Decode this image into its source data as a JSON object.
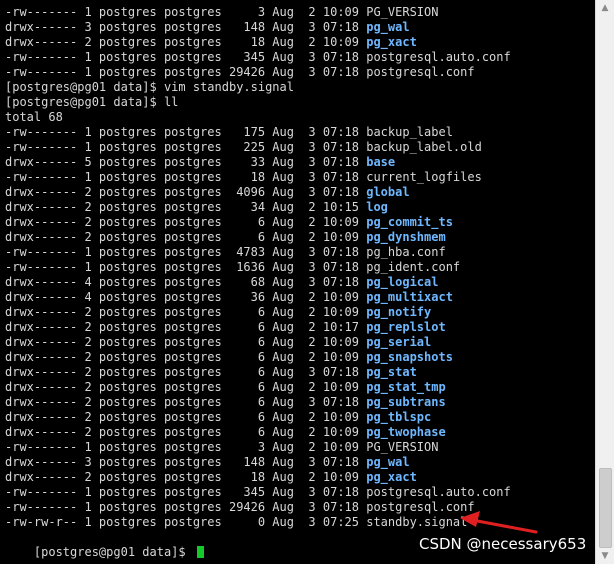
{
  "terminal": {
    "lines": [
      {
        "prefix": "-rw------- 1 postgres postgres     3 Aug  2 10:09 ",
        "name": "PG_VERSION",
        "dir": false
      },
      {
        "prefix": "drwx------ 3 postgres postgres   148 Aug  3 07:18 ",
        "name": "pg_wal",
        "dir": true
      },
      {
        "prefix": "drwx------ 2 postgres postgres    18 Aug  2 10:09 ",
        "name": "pg_xact",
        "dir": true
      },
      {
        "prefix": "-rw------- 1 postgres postgres   345 Aug  3 07:18 ",
        "name": "postgresql.auto.conf",
        "dir": false
      },
      {
        "prefix": "-rw------- 1 postgres postgres 29426 Aug  3 07:18 ",
        "name": "postgresql.conf",
        "dir": false
      },
      {
        "prefix": "[postgres@pg01 data]$ vim standby.signal",
        "name": "",
        "dir": false
      },
      {
        "prefix": "[postgres@pg01 data]$ ll",
        "name": "",
        "dir": false
      },
      {
        "prefix": "total 68",
        "name": "",
        "dir": false
      },
      {
        "prefix": "-rw------- 1 postgres postgres   175 Aug  3 07:18 ",
        "name": "backup_label",
        "dir": false
      },
      {
        "prefix": "-rw------- 1 postgres postgres   225 Aug  3 07:18 ",
        "name": "backup_label.old",
        "dir": false
      },
      {
        "prefix": "drwx------ 5 postgres postgres    33 Aug  3 07:18 ",
        "name": "base",
        "dir": true
      },
      {
        "prefix": "-rw------- 1 postgres postgres    18 Aug  3 07:18 ",
        "name": "current_logfiles",
        "dir": false
      },
      {
        "prefix": "drwx------ 2 postgres postgres  4096 Aug  3 07:18 ",
        "name": "global",
        "dir": true
      },
      {
        "prefix": "drwx------ 2 postgres postgres    34 Aug  2 10:15 ",
        "name": "log",
        "dir": true
      },
      {
        "prefix": "drwx------ 2 postgres postgres     6 Aug  2 10:09 ",
        "name": "pg_commit_ts",
        "dir": true
      },
      {
        "prefix": "drwx------ 2 postgres postgres     6 Aug  2 10:09 ",
        "name": "pg_dynshmem",
        "dir": true
      },
      {
        "prefix": "-rw------- 1 postgres postgres  4783 Aug  3 07:18 ",
        "name": "pg_hba.conf",
        "dir": false
      },
      {
        "prefix": "-rw------- 1 postgres postgres  1636 Aug  3 07:18 ",
        "name": "pg_ident.conf",
        "dir": false
      },
      {
        "prefix": "drwx------ 4 postgres postgres    68 Aug  3 07:18 ",
        "name": "pg_logical",
        "dir": true
      },
      {
        "prefix": "drwx------ 4 postgres postgres    36 Aug  2 10:09 ",
        "name": "pg_multixact",
        "dir": true
      },
      {
        "prefix": "drwx------ 2 postgres postgres     6 Aug  2 10:09 ",
        "name": "pg_notify",
        "dir": true
      },
      {
        "prefix": "drwx------ 2 postgres postgres     6 Aug  2 10:17 ",
        "name": "pg_replslot",
        "dir": true
      },
      {
        "prefix": "drwx------ 2 postgres postgres     6 Aug  2 10:09 ",
        "name": "pg_serial",
        "dir": true
      },
      {
        "prefix": "drwx------ 2 postgres postgres     6 Aug  2 10:09 ",
        "name": "pg_snapshots",
        "dir": true
      },
      {
        "prefix": "drwx------ 2 postgres postgres     6 Aug  3 07:18 ",
        "name": "pg_stat",
        "dir": true
      },
      {
        "prefix": "drwx------ 2 postgres postgres     6 Aug  2 10:09 ",
        "name": "pg_stat_tmp",
        "dir": true
      },
      {
        "prefix": "drwx------ 2 postgres postgres     6 Aug  3 07:18 ",
        "name": "pg_subtrans",
        "dir": true
      },
      {
        "prefix": "drwx------ 2 postgres postgres     6 Aug  2 10:09 ",
        "name": "pg_tblspc",
        "dir": true
      },
      {
        "prefix": "drwx------ 2 postgres postgres     6 Aug  2 10:09 ",
        "name": "pg_twophase",
        "dir": true
      },
      {
        "prefix": "-rw------- 1 postgres postgres     3 Aug  2 10:09 ",
        "name": "PG_VERSION",
        "dir": false
      },
      {
        "prefix": "drwx------ 3 postgres postgres   148 Aug  3 07:18 ",
        "name": "pg_wal",
        "dir": true
      },
      {
        "prefix": "drwx------ 2 postgres postgres    18 Aug  2 10:09 ",
        "name": "pg_xact",
        "dir": true
      },
      {
        "prefix": "-rw------- 1 postgres postgres   345 Aug  3 07:18 ",
        "name": "postgresql.auto.conf",
        "dir": false
      },
      {
        "prefix": "-rw------- 1 postgres postgres 29426 Aug  3 07:18 ",
        "name": "postgresql.conf",
        "dir": false
      },
      {
        "prefix": "-rw-rw-r-- 1 postgres postgres     0 Aug  3 07:25 ",
        "name": "standby.signal",
        "dir": false
      }
    ],
    "prompt": "[postgres@pg01 data]$ ",
    "colors": {
      "background": "#000000",
      "text": "#d8d8d8",
      "directory": "#6fb8ff",
      "cursor": "#17c82a",
      "annotation": "#e02020"
    }
  },
  "watermark": "CSDN @necessary653",
  "scrollbar": {
    "up_icon": "arrow-up-icon",
    "down_icon": "arrow-down-icon"
  }
}
